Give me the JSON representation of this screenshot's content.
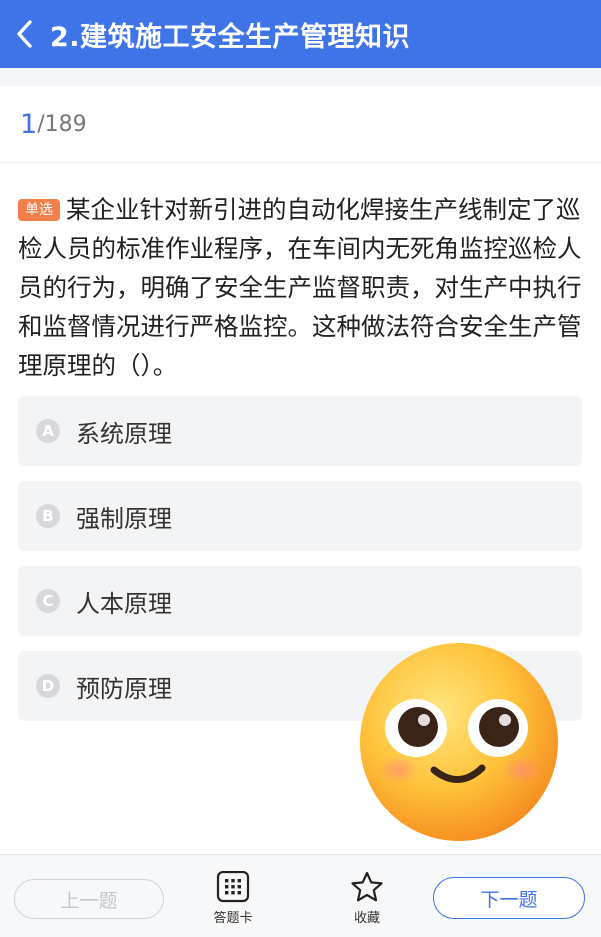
{
  "header": {
    "title": "2.建筑施工安全生产管理知识"
  },
  "progress": {
    "current": "1",
    "total": "/189"
  },
  "question": {
    "type_label": "单选",
    "text": "某企业针对新引进的自动化焊接生产线制定了巡检人员的标准作业程序，在车间内无死角监控巡检人员的行为，明确了安全生产监督职责，对生产中执行和监督情况进行严格监控。这种做法符合安全生产管理原理的（）。"
  },
  "options": [
    {
      "letter": "A",
      "text": "系统原理"
    },
    {
      "letter": "B",
      "text": "强制原理"
    },
    {
      "letter": "C",
      "text": "人本原理"
    },
    {
      "letter": "D",
      "text": "预防原理"
    }
  ],
  "footer": {
    "prev_label": "上一题",
    "answer_card_label": "答题卡",
    "favorite_label": "收藏",
    "next_label": "下一题"
  },
  "colors": {
    "primary": "#3f73e8",
    "type_badge": "#f3804a",
    "option_bg": "#f3f4f6"
  },
  "icons": [
    "back-icon",
    "grid-icon",
    "star-icon",
    "smiling-face-emoji"
  ]
}
